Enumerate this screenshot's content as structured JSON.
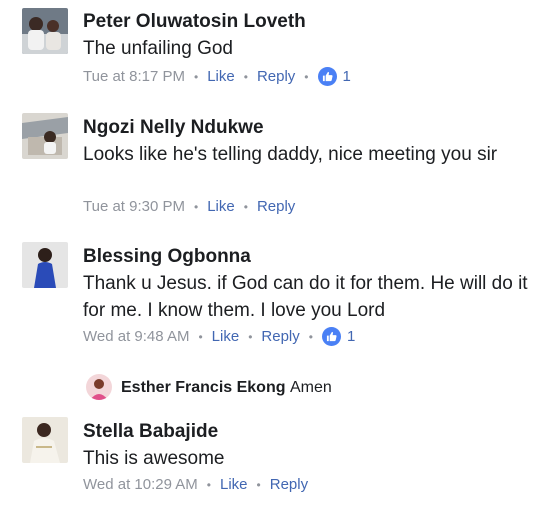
{
  "labels": {
    "like": "Like",
    "reply": "Reply"
  },
  "colors": {
    "link": "#4267b2",
    "meta": "#90949c",
    "like_badge": "#4a80f5",
    "text": "#1c1e21"
  },
  "comments": [
    {
      "name": "Peter Oluwatosin Loveth",
      "text": "The unfailing God",
      "time": "Tue at 8:17 PM",
      "likes": "1"
    },
    {
      "name": "Ngozi Nelly Ndukwe",
      "text": "Looks like he's telling daddy, nice meeting you sir",
      "time": "Tue at 9:30 PM"
    },
    {
      "name": "Blessing Ogbonna",
      "text": "Thank u Jesus. if  God can do it for them.  He will do it for me.  I know  them. I love you Lord",
      "time": "Wed at 9:48 AM",
      "likes": "1",
      "reply": {
        "name": "Esther Francis Ekong",
        "text": "Amen"
      }
    },
    {
      "name": "Stella Babajide",
      "text": "This is awesome",
      "time": "Wed at 10:29 AM"
    }
  ]
}
